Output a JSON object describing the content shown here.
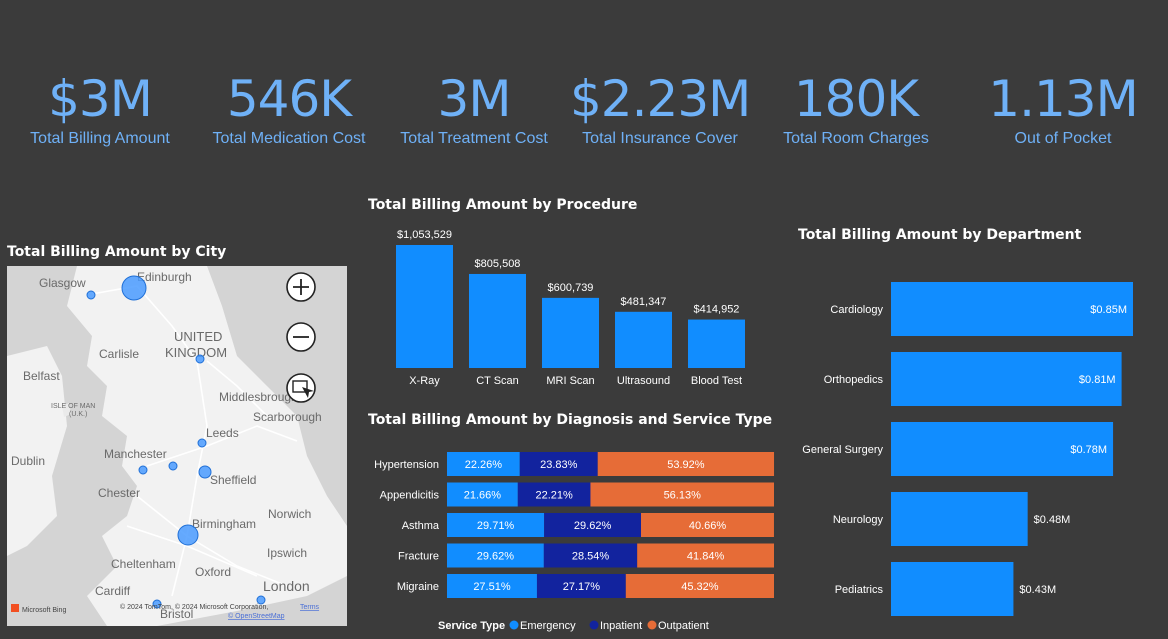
{
  "kpis": [
    {
      "value": "$3M",
      "label": "Total Billing Amount"
    },
    {
      "value": "546K",
      "label": "Total Medication Cost"
    },
    {
      "value": "3M",
      "label": "Total Treatment Cost"
    },
    {
      "value": "$2.23M",
      "label": "Total Insurance Cover"
    },
    {
      "value": "180K",
      "label": "Total Room Charges"
    },
    {
      "value": "1.13M",
      "label": "Out of Pocket"
    }
  ],
  "map": {
    "title": "Total Billing Amount by City",
    "place_labels": [
      "Glasgow",
      "Edinburgh",
      "UNITED KINGDOM",
      "Carlisle",
      "Belfast",
      "ISLE OF MAN (U.K.)",
      "Middlesbrough",
      "Scarborough",
      "Leeds",
      "Dublin",
      "Manchester",
      "Sheffield",
      "Chester",
      "Birmingham",
      "Norwich",
      "Ipswich",
      "Cheltenham",
      "Oxford",
      "Cardiff",
      "London",
      "Bristol"
    ],
    "attribution": "© 2024 TomTom, © 2024 Microsoft Corporation,",
    "terms": "Terms",
    "osm": "© OpenStreetMap",
    "bing": "Microsoft Bing",
    "icons": [
      "zoom-in-icon",
      "zoom-out-icon",
      "select-icon"
    ]
  },
  "chart_data": [
    {
      "type": "bar",
      "title": "Total Billing Amount by Procedure",
      "categories": [
        "X-Ray",
        "CT Scan",
        "MRI Scan",
        "Ultrasound",
        "Blood Test"
      ],
      "values": [
        1053529,
        805508,
        600739,
        481347,
        414952
      ],
      "data_labels": [
        "$1,053,529",
        "$805,508",
        "$600,739",
        "$481,347",
        "$414,952"
      ],
      "color": "#118dff"
    },
    {
      "type": "bar",
      "orientation": "horizontal",
      "stacked": "100%",
      "title": "Total Billing Amount by Diagnosis and Service Type",
      "categories": [
        "Hypertension",
        "Appendicitis",
        "Asthma",
        "Fracture",
        "Migraine"
      ],
      "legend_title": "Service Type",
      "legend_placement": "bottom",
      "series": [
        {
          "name": "Emergency",
          "color": "#118dff",
          "values": [
            22.26,
            21.66,
            29.71,
            29.62,
            27.51
          ],
          "labels": [
            "22.26%",
            "21.66%",
            "29.71%",
            "29.62%",
            "27.51%"
          ]
        },
        {
          "name": "Inpatient",
          "color": "#12239e",
          "values": [
            23.83,
            22.21,
            29.62,
            28.54,
            27.17
          ],
          "labels": [
            "23.83%",
            "22.21%",
            "29.62%",
            "28.54%",
            "27.17%"
          ]
        },
        {
          "name": "Outpatient",
          "color": "#e66c37",
          "values": [
            53.92,
            56.13,
            40.66,
            41.84,
            45.32
          ],
          "labels": [
            "53.92%",
            "56.13%",
            "40.66%",
            "41.84%",
            "45.32%"
          ]
        }
      ]
    },
    {
      "type": "bar",
      "orientation": "horizontal",
      "title": "Total Billing Amount by Department",
      "categories": [
        "Cardiology",
        "Orthopedics",
        "General Surgery",
        "Neurology",
        "Pediatrics"
      ],
      "values": [
        0.85,
        0.81,
        0.78,
        0.48,
        0.43
      ],
      "data_labels": [
        "$0.85M",
        "$0.81M",
        "$0.78M",
        "$0.48M",
        "$0.43M"
      ],
      "color": "#118dff"
    }
  ]
}
